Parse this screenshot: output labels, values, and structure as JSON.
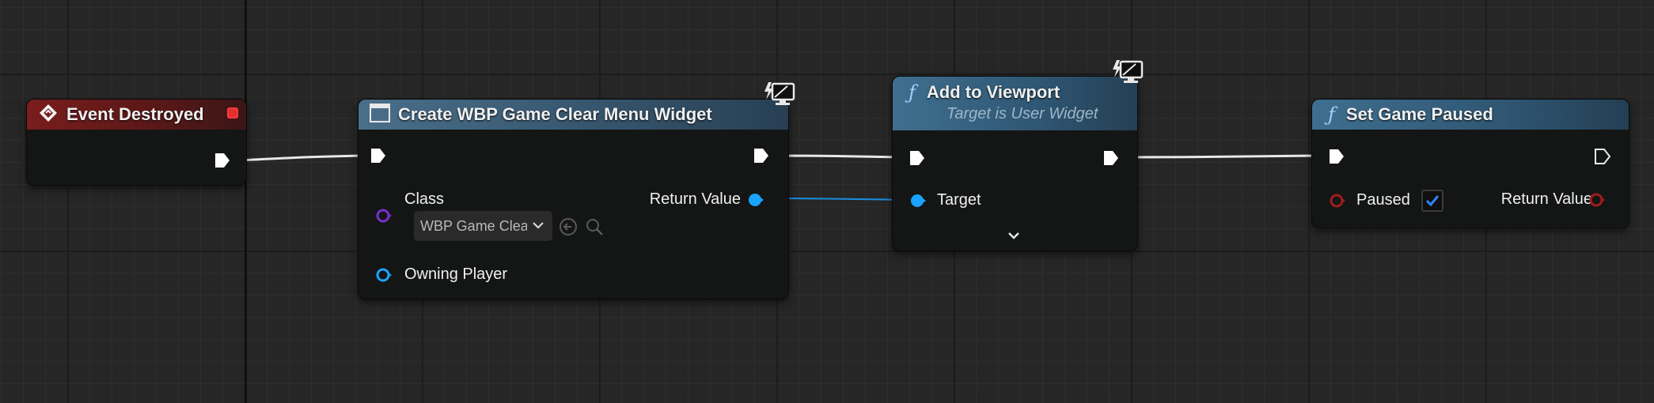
{
  "graph": {
    "nodes": {
      "event_destroyed": {
        "title": "Event Destroyed",
        "color": "#7a1d1d"
      },
      "create_widget": {
        "title": "Create WBP Game Clear Menu Widget",
        "class_label": "Class",
        "class_value": "WBP Game Clea",
        "return_label": "Return Value",
        "owning_label": "Owning Player",
        "color": "#2c4c66"
      },
      "add_to_viewport": {
        "title": "Add to Viewport",
        "subtitle": "Target is User Widget",
        "target_label": "Target",
        "color": "#3a6a8a"
      },
      "set_game_paused": {
        "title": "Set Game Paused",
        "paused_label": "Paused",
        "paused_checked": true,
        "return_label": "Return Value",
        "color": "#3a6a8a"
      }
    },
    "colors": {
      "exec_pin": "#ffffff",
      "object_pin": "#1aa3ff",
      "class_pin": "#7a2fd0",
      "bool_pin": "#a11c1c",
      "checkbox_check": "#2e86ff"
    },
    "icons": [
      "event-icon",
      "function-icon",
      "widget-icon",
      "monitor-icon",
      "chevron-down-icon",
      "browse-icon",
      "search-icon"
    ]
  }
}
